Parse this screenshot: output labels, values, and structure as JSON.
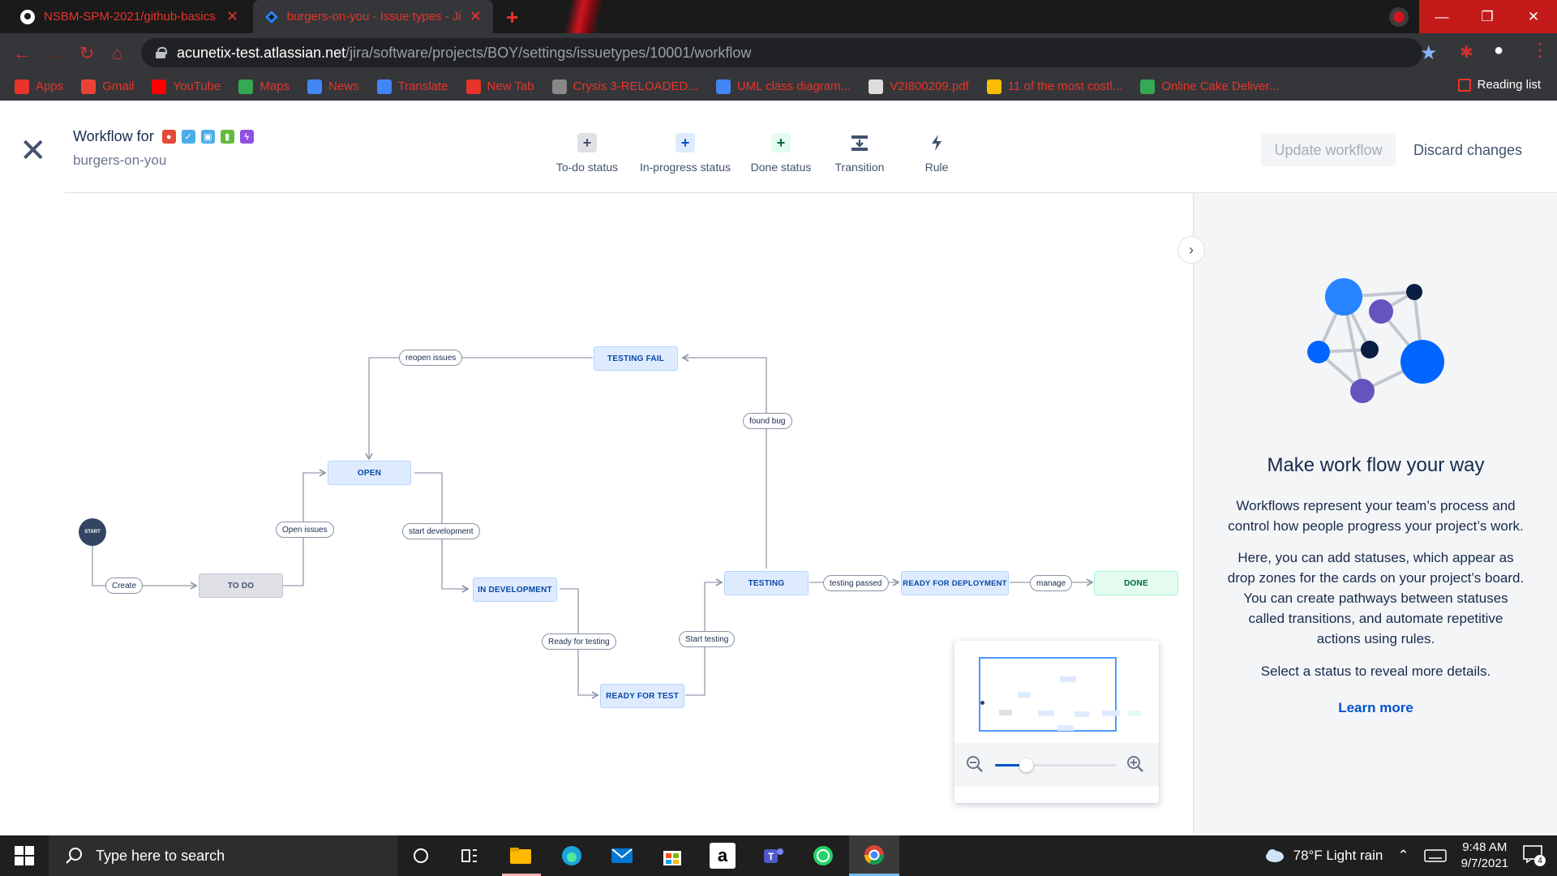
{
  "browser": {
    "tabs": [
      {
        "title": "NSBM-SPM-2021/github-basics",
        "active": false
      },
      {
        "title": "burgers-on-you - Issue types - Ji",
        "active": true
      }
    ],
    "url_host": "acunetix-test.atlassian.net",
    "url_path": "/jira/software/projects/BOY/settings/issuetypes/10001/workflow",
    "bookmarks": [
      {
        "label": "Apps",
        "icon": "apps-grid-icon",
        "color": "#e8342a"
      },
      {
        "label": "Gmail",
        "icon": "gmail-icon",
        "color": "#ea4335"
      },
      {
        "label": "YouTube",
        "icon": "youtube-icon",
        "color": "#ff0000"
      },
      {
        "label": "Maps",
        "icon": "maps-icon",
        "color": "#34a853"
      },
      {
        "label": "News",
        "icon": "news-icon",
        "color": "#4285f4"
      },
      {
        "label": "Translate",
        "icon": "translate-icon",
        "color": "#4285f4"
      },
      {
        "label": "New Tab",
        "icon": "opera-icon",
        "color": "#e8342a"
      },
      {
        "label": "Crysis 3-RELOADED...",
        "icon": "site-icon",
        "color": "#888888"
      },
      {
        "label": "UML class diagram...",
        "icon": "diagram-icon",
        "color": "#4285f4"
      },
      {
        "label": "V2I800209.pdf",
        "icon": "pdf-icon",
        "color": "#dddddd"
      },
      {
        "label": "11 of the most costl...",
        "icon": "star-site-icon",
        "color": "#fbbc04"
      },
      {
        "label": "Online Cake Deliver...",
        "icon": "cake-site-icon",
        "color": "#34a853"
      }
    ],
    "reading_list": "Reading list"
  },
  "header": {
    "title_prefix": "Workflow for",
    "project": "burgers-on-you",
    "issue_types": [
      {
        "name": "bug-type-icon",
        "color": "#e5493a",
        "glyph": "●"
      },
      {
        "name": "task-type-icon",
        "color": "#4bade8",
        "glyph": "✓"
      },
      {
        "name": "subtask-type-icon",
        "color": "#4bade8",
        "glyph": "▣"
      },
      {
        "name": "story-type-icon",
        "color": "#63ba3c",
        "glyph": "▮"
      },
      {
        "name": "epic-type-icon",
        "color": "#904ee2",
        "glyph": "ϟ"
      }
    ],
    "tools": [
      {
        "label": "To-do status",
        "icon": "plus-icon",
        "bg": "#dfe1e6",
        "color": "#42526e"
      },
      {
        "label": "In-progress status",
        "icon": "plus-icon",
        "bg": "#deebff",
        "color": "#0052cc"
      },
      {
        "label": "Done status",
        "icon": "plus-icon",
        "bg": "#e3fcef",
        "color": "#006644"
      },
      {
        "label": "Transition",
        "icon": "transition-icon",
        "bg": "#ffffff",
        "color": "#42526e"
      },
      {
        "label": "Rule",
        "icon": "lightning-icon",
        "bg": "#ffffff",
        "color": "#42526e"
      }
    ],
    "update_button": "Update workflow",
    "discard_button": "Discard changes"
  },
  "workflow": {
    "start_label": "START",
    "statuses": {
      "todo": "TO DO",
      "open": "OPEN",
      "in_dev": "IN DEVELOPMENT",
      "ready_test": "READY FOR TEST",
      "testing": "TESTING",
      "testing_fail": "TESTING FAIL",
      "ready_deploy": "READY FOR DEPLOYMENT",
      "done": "DONE"
    },
    "transitions": {
      "create": "Create",
      "open_issues": "Open issues",
      "start_dev": "start development",
      "ready_testing": "Ready for testing",
      "start_testing": "Start testing",
      "found_bug": "found bug",
      "reopen": "reopen issues",
      "testing_passed": "testing passed",
      "manage": "manage"
    },
    "zoom_level": 0.25
  },
  "panel": {
    "title": "Make work flow your way",
    "para1": "Workflows represent your team’s process and control how people progress your project’s work.",
    "para2": "Here, you can add statuses, which appear as drop zones for the cards on your project’s board. You can create pathways between statuses called transitions, and automate repetitive actions using rules.",
    "para3": "Select a status to reveal more details.",
    "learn_more": "Learn more"
  },
  "taskbar": {
    "search_placeholder": "Type here to search",
    "weather": "78°F  Light rain",
    "time": "9:48 AM",
    "date": "9/7/2021",
    "notifications": "4"
  }
}
